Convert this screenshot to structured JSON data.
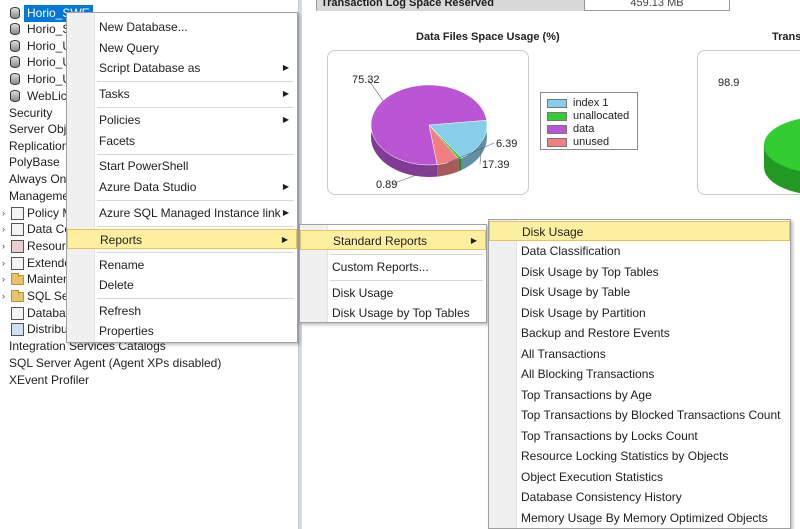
{
  "explorer": {
    "items": [
      {
        "label": "Horio_SWE",
        "icon": "database-icon",
        "selected": true
      },
      {
        "label": "Horio_S",
        "icon": "database-icon"
      },
      {
        "label": "Horio_U",
        "icon": "database-icon"
      },
      {
        "label": "Horio_U",
        "icon": "database-icon"
      },
      {
        "label": "Horio_U",
        "icon": "database-icon"
      },
      {
        "label": "WebLice",
        "icon": "database-icon"
      },
      {
        "label": "Security",
        "icon": "folder-icon"
      },
      {
        "label": "Server Obje",
        "icon": "folder-icon"
      },
      {
        "label": "Replication",
        "icon": "folder-icon"
      },
      {
        "label": "PolyBase",
        "icon": "folder-icon"
      },
      {
        "label": "Always On I",
        "icon": "folder-icon"
      },
      {
        "label": "Manageme",
        "icon": "folder-icon"
      },
      {
        "label": "Policy M",
        "icon": "gear-icon"
      },
      {
        "label": "Data Co",
        "icon": "gear-icon"
      },
      {
        "label": "Resourc",
        "icon": "gear-icon"
      },
      {
        "label": "Extende",
        "icon": "gear-icon"
      },
      {
        "label": "Mainten",
        "icon": "folder-icon"
      },
      {
        "label": "SQL Serv",
        "icon": "folder-icon"
      },
      {
        "label": "Databas",
        "icon": "gear-icon"
      },
      {
        "label": "Distribu",
        "icon": "gear-icon"
      },
      {
        "label": "Integration Services Catalogs",
        "icon": "folder-icon"
      },
      {
        "label": "SQL Server Agent (Agent XPs disabled)",
        "icon": "agent-icon"
      },
      {
        "label": "XEvent Profiler",
        "icon": "profiler-icon"
      }
    ]
  },
  "report": {
    "tlog_label": "Transaction Log Space Reserved",
    "tlog_value": "459.13 MB",
    "chart1_title": "Data Files Space Usage (%)",
    "chart2_title": "Trans",
    "chart2_label": "98.9"
  },
  "chart_data": {
    "type": "pie",
    "title": "Data Files Space Usage (%)",
    "labels": [
      "index 1",
      "unallocated",
      "data",
      "unused"
    ],
    "values": [
      17.39,
      0.89,
      75.32,
      6.39
    ],
    "colors": [
      "#87ceeb",
      "#32cd32",
      "#ba55d3",
      "#f08080"
    ],
    "legend_position": "right"
  },
  "menu_main": {
    "items": [
      {
        "label": "New Database...",
        "arrow": false
      },
      {
        "label": "New Query",
        "arrow": false
      },
      {
        "label": "Script Database as",
        "arrow": true
      },
      {
        "label": "Tasks",
        "arrow": true
      },
      {
        "label": "Policies",
        "arrow": true
      },
      {
        "label": "Facets",
        "arrow": false
      },
      {
        "label": "Start PowerShell",
        "arrow": false
      },
      {
        "label": "Azure Data Studio",
        "arrow": true
      },
      {
        "label": "Azure SQL Managed Instance link",
        "arrow": true
      },
      {
        "label": "Reports",
        "arrow": true,
        "highlighted": true
      },
      {
        "label": "Rename",
        "arrow": false
      },
      {
        "label": "Delete",
        "arrow": false
      },
      {
        "label": "Refresh",
        "arrow": false
      },
      {
        "label": "Properties",
        "arrow": false
      }
    ]
  },
  "menu_reports": {
    "items": [
      {
        "label": "Standard Reports",
        "arrow": true,
        "highlighted": true
      },
      {
        "label": "Custom Reports...",
        "arrow": false
      },
      {
        "label": "Disk Usage",
        "arrow": false
      },
      {
        "label": "Disk Usage by Top Tables",
        "arrow": false
      }
    ]
  },
  "menu_standard": {
    "items": [
      {
        "label": "Disk Usage",
        "highlighted": true
      },
      {
        "label": "Data Classification"
      },
      {
        "label": "Disk Usage by Top Tables"
      },
      {
        "label": "Disk Usage by Table"
      },
      {
        "label": "Disk Usage by Partition"
      },
      {
        "label": "Backup and Restore Events"
      },
      {
        "label": "All Transactions"
      },
      {
        "label": "All Blocking Transactions"
      },
      {
        "label": "Top Transactions by Age"
      },
      {
        "label": "Top Transactions by Blocked Transactions Count"
      },
      {
        "label": "Top Transactions by Locks Count"
      },
      {
        "label": "Resource Locking Statistics by Objects"
      },
      {
        "label": "Object Execution Statistics"
      },
      {
        "label": "Database Consistency History"
      },
      {
        "label": "Memory Usage By Memory Optimized Objects"
      }
    ]
  },
  "colors": {
    "selection": "#0078d7",
    "menu_highlight": "#fcefa0",
    "menu_highlight_border": "#e5c365"
  }
}
